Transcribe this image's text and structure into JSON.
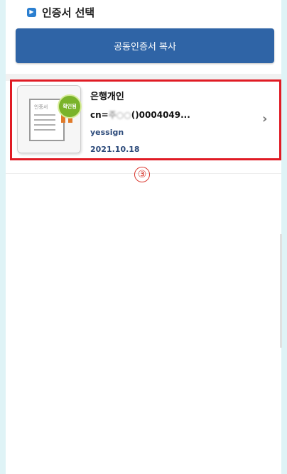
{
  "section": {
    "title": "인증서 선택",
    "bullet_icon": "chevron-right-icon"
  },
  "copy_button": {
    "label": "공동인증서 복사"
  },
  "certificate": {
    "name": "은행개인",
    "cn_prefix": "cn=",
    "cn_masked": "주○○",
    "cn_suffix": "()0004049...",
    "issuer": "yessign",
    "date": "2021.10.18",
    "thumb_caption": "인증서",
    "seal_text": "확인됨"
  },
  "step_marker": "③",
  "colors": {
    "accent": "#2f64a6",
    "highlight": "#e01b24",
    "page_bg": "#dff3f6"
  }
}
